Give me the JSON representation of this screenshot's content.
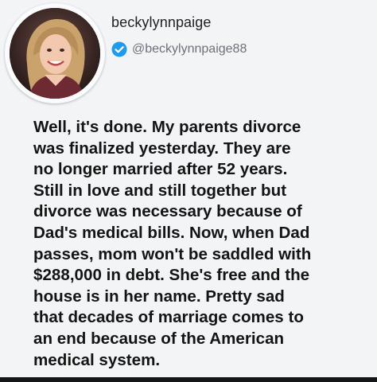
{
  "profile": {
    "username": "beckylynnpaige",
    "handle": "@beckylynnpaige88",
    "verified_icon": "verified-check-icon",
    "accent_color": "#1d9bf0"
  },
  "post": {
    "text": "Well, it's done. My parents divorce\nwas finalized yesterday. They are\nno longer married after 52 years.\nStill in love and still together but\ndivorce was necessary because of\nDad's medical bills. Now, when Dad\npasses, mom won't be saddled with\n$288,000 in debt. She's free and the\nhouse is in her name. Pretty sad\nthat decades of marriage comes to\nan end because of the American\nmedical system."
  }
}
